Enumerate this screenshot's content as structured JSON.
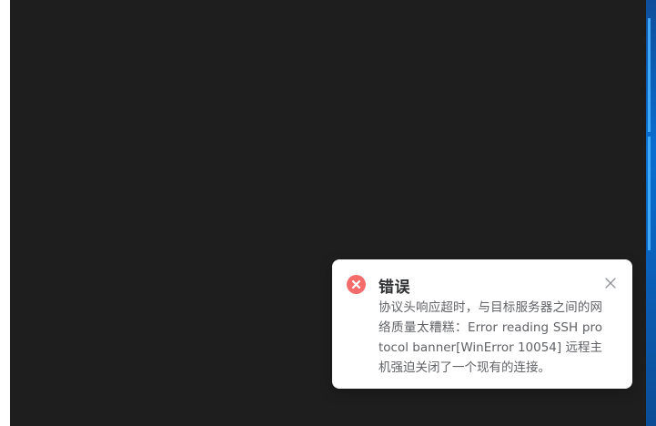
{
  "background": {
    "terminal_color": "#1e1e1e",
    "right_edge_color": "#0a6ed1"
  },
  "notification": {
    "type": "error",
    "icon": "error-circle-icon",
    "accent_color": "#f56c6c",
    "title": "错误",
    "message": "协议头响应超时，与目标服务器之间的网络质量太糟糕：Error reading SSH protocol banner[WinError 10054] 远程主机强迫关闭了一个现有的连接。",
    "close_icon": "close-icon"
  }
}
